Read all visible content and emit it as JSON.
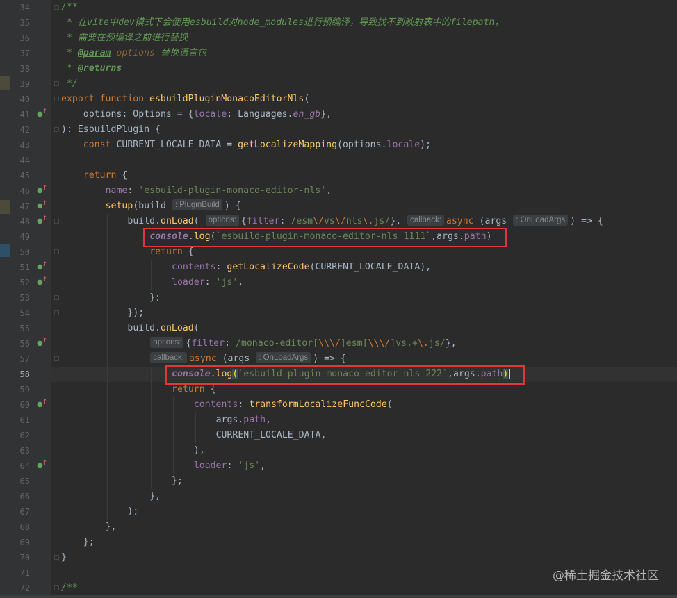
{
  "editor": {
    "current_line": 58,
    "lines": [
      {
        "n": 34,
        "indent": 0,
        "tokens": [
          {
            "t": "/**",
            "c": "cmt"
          }
        ]
      },
      {
        "n": 35,
        "indent": 1,
        "tokens": [
          {
            "t": "* 在vite中dev模式下会使用esbuild对node_modules进行预编译，导致找不到映射表中的filepath，",
            "c": "cmt"
          }
        ]
      },
      {
        "n": 36,
        "indent": 1,
        "tokens": [
          {
            "t": "* 需要在预编译之前进行替换",
            "c": "cmt"
          }
        ]
      },
      {
        "n": 37,
        "indent": 1,
        "tokens": [
          {
            "t": "* ",
            "c": "cmt"
          },
          {
            "t": "@param",
            "c": "tag"
          },
          {
            "t": " options",
            "c": "prm"
          },
          {
            "t": " 替换语言包",
            "c": "cmt"
          }
        ]
      },
      {
        "n": 38,
        "indent": 1,
        "tokens": [
          {
            "t": "* ",
            "c": "cmt"
          },
          {
            "t": "@returns",
            "c": "tag"
          }
        ]
      },
      {
        "n": 39,
        "indent": 1,
        "tokens": [
          {
            "t": "*/",
            "c": "cmt"
          }
        ]
      },
      {
        "n": 40,
        "indent": 0,
        "tokens": [
          {
            "t": "export function ",
            "c": "kw"
          },
          {
            "t": "esbuildPluginMonacoEditorNls",
            "c": "fn"
          },
          {
            "t": "("
          }
        ]
      },
      {
        "n": 41,
        "indent": 4,
        "tokens": [
          {
            "t": "options: Options = {"
          },
          {
            "t": "locale",
            "c": "prop"
          },
          {
            "t": ": Languages."
          },
          {
            "t": "en_gb",
            "c": "const"
          },
          {
            "t": "},"
          }
        ]
      },
      {
        "n": 42,
        "indent": 0,
        "tokens": [
          {
            "t": "): EsbuildPlugin {"
          }
        ]
      },
      {
        "n": 43,
        "indent": 4,
        "tokens": [
          {
            "t": "const ",
            "c": "kw"
          },
          {
            "t": "CURRENT_LOCALE_DATA = "
          },
          {
            "t": "getLocalizeMapping",
            "c": "fn"
          },
          {
            "t": "(options."
          },
          {
            "t": "locale",
            "c": "prop"
          },
          {
            "t": ");"
          }
        ]
      },
      {
        "n": 44,
        "indent": 0,
        "tokens": []
      },
      {
        "n": 45,
        "indent": 4,
        "tokens": [
          {
            "t": "return ",
            "c": "kw"
          },
          {
            "t": "{"
          }
        ]
      },
      {
        "n": 46,
        "indent": 8,
        "tokens": [
          {
            "t": "name",
            "c": "prop"
          },
          {
            "t": ": "
          },
          {
            "t": "'esbuild-plugin-monaco-editor-nls'",
            "c": "str"
          },
          {
            "t": ","
          }
        ]
      },
      {
        "n": 47,
        "indent": 8,
        "tokens": [
          {
            "t": "setup",
            "c": "fn"
          },
          {
            "t": "(build "
          },
          {
            "h": ": PluginBuild"
          },
          {
            "t": ") {"
          }
        ]
      },
      {
        "n": 48,
        "indent": 12,
        "tokens": [
          {
            "t": "build."
          },
          {
            "t": "onLoad",
            "c": "fn"
          },
          {
            "t": "( "
          },
          {
            "h": "options:"
          },
          {
            "t": "{"
          },
          {
            "t": "filter",
            "c": "prop"
          },
          {
            "t": ": "
          },
          {
            "t": "/esm",
            "c": "rx"
          },
          {
            "t": "\\/",
            "c": "rxe"
          },
          {
            "t": "vs",
            "c": "rx"
          },
          {
            "t": "\\/",
            "c": "rxe"
          },
          {
            "t": "nls",
            "c": "rx"
          },
          {
            "t": "\\.",
            "c": "rxe"
          },
          {
            "t": "js/",
            "c": "rx"
          },
          {
            "t": "}, "
          },
          {
            "h": "callback:"
          },
          {
            "t": "async ",
            "c": "kw"
          },
          {
            "t": "(args "
          },
          {
            "h": ": OnLoadArgs"
          },
          {
            "t": ") => {"
          }
        ]
      },
      {
        "n": 49,
        "indent": 16,
        "tokens": [
          {
            "t": "console",
            "c": "conslog"
          },
          {
            "t": "."
          },
          {
            "t": "log",
            "c": "fn"
          },
          {
            "t": "("
          },
          {
            "t": "`esbuild-plugin-monaco-editor-nls 1111`",
            "c": "str"
          },
          {
            "t": ",args."
          },
          {
            "t": "path",
            "c": "prop"
          },
          {
            "t": ")"
          }
        ]
      },
      {
        "n": 50,
        "indent": 16,
        "tokens": [
          {
            "t": "return ",
            "c": "kw"
          },
          {
            "t": "{"
          }
        ]
      },
      {
        "n": 51,
        "indent": 20,
        "tokens": [
          {
            "t": "contents",
            "c": "prop"
          },
          {
            "t": ": "
          },
          {
            "t": "getLocalizeCode",
            "c": "fn"
          },
          {
            "t": "(CURRENT_LOCALE_DATA),"
          }
        ]
      },
      {
        "n": 52,
        "indent": 20,
        "tokens": [
          {
            "t": "loader",
            "c": "prop"
          },
          {
            "t": ": "
          },
          {
            "t": "'js'",
            "c": "str"
          },
          {
            "t": ","
          }
        ]
      },
      {
        "n": 53,
        "indent": 16,
        "tokens": [
          {
            "t": "};"
          }
        ]
      },
      {
        "n": 54,
        "indent": 12,
        "tokens": [
          {
            "t": "});"
          }
        ]
      },
      {
        "n": 55,
        "indent": 12,
        "tokens": [
          {
            "t": "build."
          },
          {
            "t": "onLoad",
            "c": "fn"
          },
          {
            "t": "("
          }
        ]
      },
      {
        "n": 56,
        "indent": 16,
        "tokens": [
          {
            "h": "options:"
          },
          {
            "t": "{"
          },
          {
            "t": "filter",
            "c": "prop"
          },
          {
            "t": ": "
          },
          {
            "t": "/monaco-editor[",
            "c": "rx"
          },
          {
            "t": "\\\\\\/",
            "c": "rxe"
          },
          {
            "t": "]esm[",
            "c": "rx"
          },
          {
            "t": "\\\\\\/",
            "c": "rxe"
          },
          {
            "t": "]vs.+",
            "c": "rx"
          },
          {
            "t": "\\.",
            "c": "rxe"
          },
          {
            "t": "js/",
            "c": "rx"
          },
          {
            "t": "},"
          }
        ]
      },
      {
        "n": 57,
        "indent": 16,
        "tokens": [
          {
            "h": "callback:"
          },
          {
            "t": "async ",
            "c": "kw"
          },
          {
            "t": "(args "
          },
          {
            "h": ": OnLoadArgs"
          },
          {
            "t": ") => {"
          }
        ]
      },
      {
        "n": 58,
        "indent": 20,
        "tokens": [
          {
            "t": "console",
            "c": "conslog"
          },
          {
            "t": "."
          },
          {
            "t": "log",
            "c": "fn"
          },
          {
            "t": "(",
            "c": "brm"
          },
          {
            "t": "`esbuild-plugin-monaco-editor-nls 222`",
            "c": "str"
          },
          {
            "t": ",args."
          },
          {
            "t": "path",
            "c": "prop"
          },
          {
            "t": ")",
            "c": "brm"
          },
          {
            "caret": true
          }
        ]
      },
      {
        "n": 59,
        "indent": 20,
        "tokens": [
          {
            "t": "return ",
            "c": "kw"
          },
          {
            "t": "{"
          }
        ]
      },
      {
        "n": 60,
        "indent": 24,
        "tokens": [
          {
            "t": "contents",
            "c": "prop"
          },
          {
            "t": ": "
          },
          {
            "t": "transformLocalizeFuncCode",
            "c": "fn"
          },
          {
            "t": "("
          }
        ]
      },
      {
        "n": 61,
        "indent": 28,
        "tokens": [
          {
            "t": "args."
          },
          {
            "t": "path",
            "c": "prop"
          },
          {
            "t": ","
          }
        ]
      },
      {
        "n": 62,
        "indent": 28,
        "tokens": [
          {
            "t": "CURRENT_LOCALE_DATA,"
          }
        ]
      },
      {
        "n": 63,
        "indent": 24,
        "tokens": [
          {
            "t": "),"
          }
        ]
      },
      {
        "n": 64,
        "indent": 24,
        "tokens": [
          {
            "t": "loader",
            "c": "prop"
          },
          {
            "t": ": "
          },
          {
            "t": "'js'",
            "c": "str"
          },
          {
            "t": ","
          }
        ]
      },
      {
        "n": 65,
        "indent": 20,
        "tokens": [
          {
            "t": "};"
          }
        ]
      },
      {
        "n": 66,
        "indent": 16,
        "tokens": [
          {
            "t": "},"
          }
        ]
      },
      {
        "n": 67,
        "indent": 12,
        "tokens": [
          {
            "t": ");"
          }
        ]
      },
      {
        "n": 68,
        "indent": 8,
        "tokens": [
          {
            "t": "},"
          }
        ]
      },
      {
        "n": 69,
        "indent": 4,
        "tokens": [
          {
            "t": "};"
          }
        ]
      },
      {
        "n": 70,
        "indent": 0,
        "tokens": [
          {
            "t": "}"
          }
        ]
      },
      {
        "n": 71,
        "indent": 0,
        "tokens": []
      },
      {
        "n": 72,
        "indent": 0,
        "tokens": [
          {
            "t": "/**",
            "c": "cmt"
          }
        ]
      }
    ],
    "gutter_override_icons": [
      41,
      46,
      47,
      48,
      51,
      52,
      56,
      60,
      64
    ],
    "fold_markers": [
      34,
      39,
      40,
      42,
      48,
      50,
      53,
      54,
      57,
      70,
      72
    ],
    "highlight_boxes": [
      49,
      58
    ]
  },
  "watermark": "@稀土掘金技术社区",
  "colors": {
    "background": "#2b2b2b",
    "gutter": "#313335",
    "highlight_box": "#e0373b",
    "current_line": "#323232"
  }
}
